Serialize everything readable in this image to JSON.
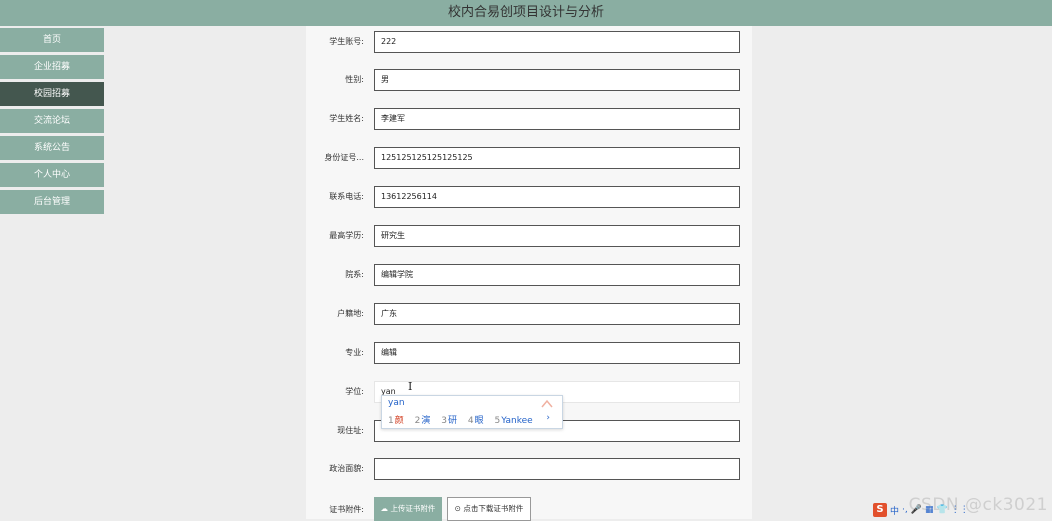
{
  "header": {
    "title": "校内合易创项目设计与分析"
  },
  "sidebar": {
    "items": [
      {
        "label": "首页",
        "active": false
      },
      {
        "label": "企业招募",
        "active": false
      },
      {
        "label": "校园招募",
        "active": true
      },
      {
        "label": "交流论坛",
        "active": false
      },
      {
        "label": "系统公告",
        "active": false
      },
      {
        "label": "个人中心",
        "active": false
      },
      {
        "label": "后台管理",
        "active": false
      }
    ]
  },
  "form": {
    "fields": [
      {
        "label": "学生账号:",
        "value": "222"
      },
      {
        "label": "性别:",
        "value": "男"
      },
      {
        "label": "学生姓名:",
        "value": "李建军"
      },
      {
        "label": "身份证号...",
        "value": "125125125125125125"
      },
      {
        "label": "联系电话:",
        "value": "13612256114"
      },
      {
        "label": "最高学历:",
        "value": "研究生"
      },
      {
        "label": "院系:",
        "value": "编辑学院"
      },
      {
        "label": "户籍地:",
        "value": "广东"
      },
      {
        "label": "专业:",
        "value": "编辑"
      },
      {
        "label": "学位:",
        "value": "yan"
      },
      {
        "label": "现住址:",
        "value": ""
      },
      {
        "label": "政治面貌:",
        "value": ""
      }
    ],
    "attachment_label": "证书附件:",
    "upload_button": "上传证书附件",
    "download_button": "点击下载证书附件"
  },
  "ime": {
    "composition": "yan",
    "candidates": [
      {
        "num": "1",
        "text": "颜"
      },
      {
        "num": "2",
        "text": "演"
      },
      {
        "num": "3",
        "text": "研"
      },
      {
        "num": "4",
        "text": "眼"
      },
      {
        "num": "5",
        "text": "Yankee"
      }
    ],
    "next": "›"
  },
  "taskbar": {
    "ime_mode": "中",
    "items": [
      "·,",
      "🎤",
      "▦",
      "👕",
      "⋮⋮"
    ]
  },
  "watermark": "CSDN @ck3021"
}
